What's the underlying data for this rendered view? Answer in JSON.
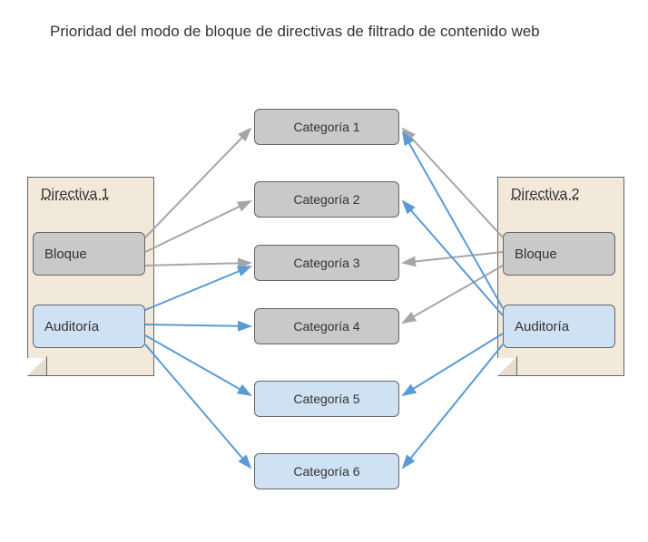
{
  "title": "Prioridad del modo de bloque de directivas de filtrado de contenido web",
  "policy1": {
    "title": "Directiva 1",
    "block": "Bloque",
    "audit": "Auditoría"
  },
  "policy2": {
    "title": "Directiva 2",
    "block": "Bloque",
    "audit": "Auditoría"
  },
  "categories": {
    "c1": "Categoría  1",
    "c2": "Categoría  2",
    "c3": "Categoría  3",
    "c4": "Categoría  4",
    "c5": "Categoría  5",
    "c6": "Categoría  6"
  },
  "colors": {
    "grey_arrow": "#a6a6a6",
    "blue_arrow": "#5b9bd5"
  }
}
